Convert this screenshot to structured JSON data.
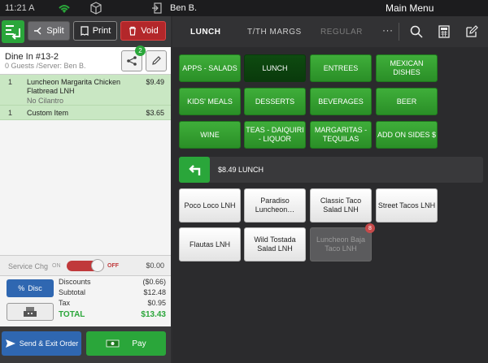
{
  "status_bar": {
    "time": "11:21 A",
    "user": "Ben B.",
    "screen_title": "Main Menu"
  },
  "toolbar": {
    "split_label": "Split",
    "print_label": "Print",
    "void_label": "Void"
  },
  "order": {
    "title": "Dine In #13-2",
    "subtitle": "0 Guests /Server: Ben B.",
    "share_count": "2",
    "items": [
      {
        "qty": "1",
        "name": "Luncheon Margarita Chicken Flatbread LNH",
        "price": "$9.49",
        "modifier": "No Cilantro"
      },
      {
        "qty": "1",
        "name": "Custom Item",
        "price": "$3.65"
      }
    ]
  },
  "service_charge": {
    "label": "Service Chg",
    "on_label": "ON",
    "off_label": "OFF",
    "amount": "$0.00"
  },
  "totals": {
    "disc_label": "Disc",
    "rows": [
      {
        "label": "Discounts",
        "value": "($0.66)"
      },
      {
        "label": "Subtotal",
        "value": "$12.48"
      },
      {
        "label": "Tax",
        "value": "$0.95"
      },
      {
        "label": "TOTAL",
        "value": "$13.43"
      }
    ]
  },
  "actions": {
    "send_label": "Send & Exit Order",
    "pay_label": "Pay"
  },
  "menu_tabs": {
    "tabs": [
      "LUNCH",
      "T/TH MARGS",
      "REGULAR"
    ],
    "more": "···"
  },
  "categories": [
    "APPS - SALADS",
    "LUNCH",
    "ENTREES",
    "MEXICAN DISHES",
    "KIDS' MEALS",
    "DESSERTS",
    "BEVERAGES",
    "BEER",
    "WINE",
    "TEAS - DAIQUIRI - LIQUOR",
    "MARGARITAS - TEQUILAS",
    "ADD ON SIDES $"
  ],
  "breadcrumb": {
    "text": "$8.49 LUNCH"
  },
  "menu_items": [
    "Poco Loco LNH",
    "Paradiso Luncheon…",
    "Classic Taco Salad LNH",
    "Street Tacos LNH",
    "Flautas LNH",
    "Wild Tostada Salad LNH",
    "Luncheon Baja Taco LNH"
  ],
  "menu_item_badge": "8",
  "colors": {
    "accent_green": "#2aa63a",
    "void_red": "#b3272a",
    "send_blue": "#2f67b1",
    "item_highlight": "#c9e7c3"
  }
}
